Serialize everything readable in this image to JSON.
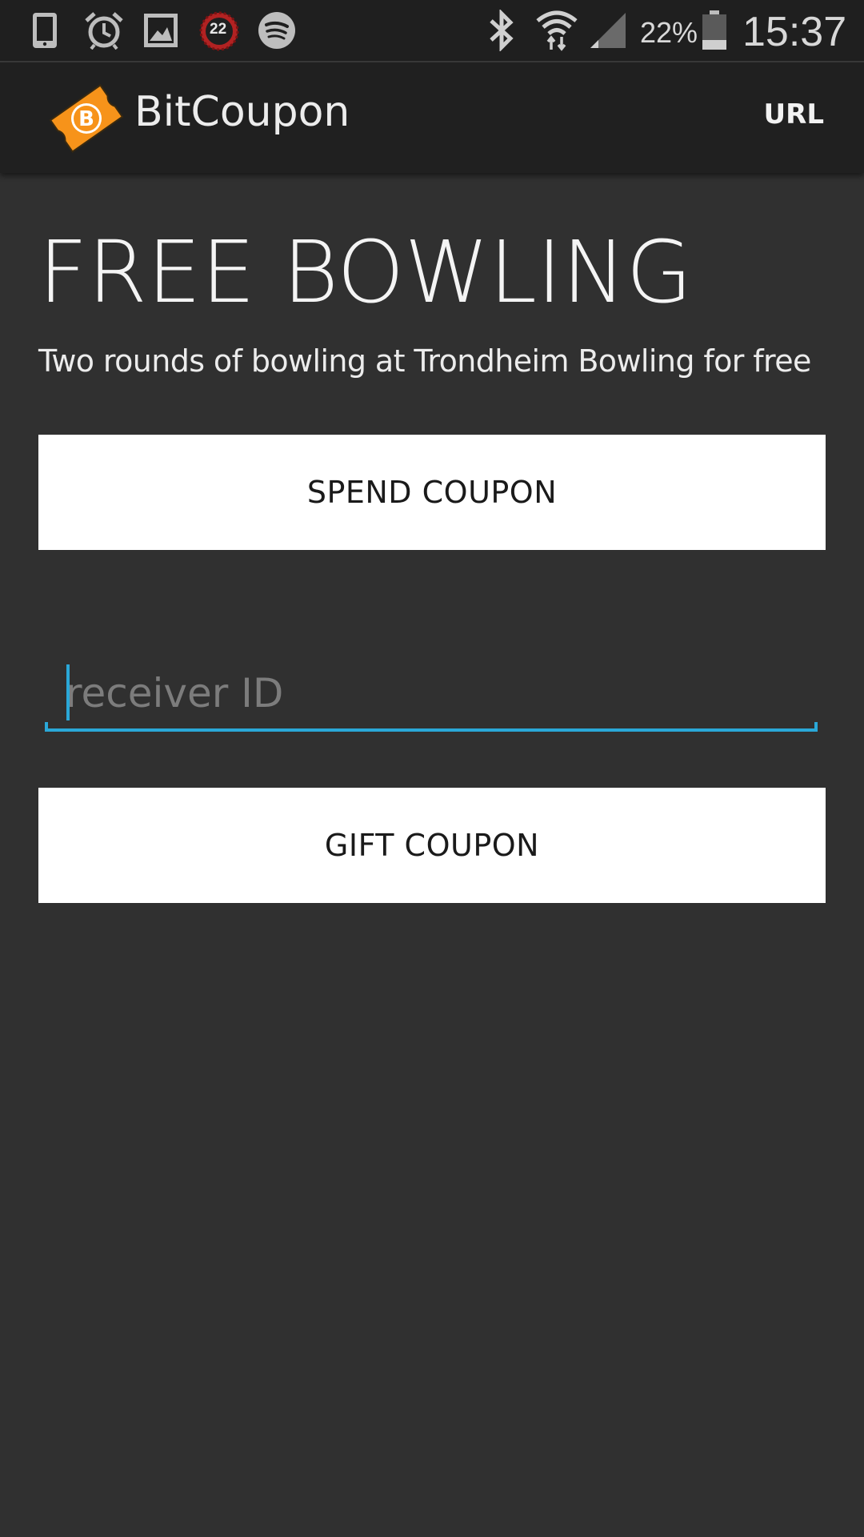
{
  "status_bar": {
    "battery_percent": "22%",
    "time": "15:37",
    "notification_badge": "22",
    "icons": [
      "phone-icon",
      "alarm-icon",
      "gallery-icon",
      "counter-badge-icon",
      "spotify-icon",
      "bluetooth-icon",
      "wifi-icon",
      "signal-icon",
      "battery-icon"
    ]
  },
  "action_bar": {
    "app_title": "BitCoupon",
    "logo_icon": "bitcoin-coupon-logo-icon",
    "url_label": "URL"
  },
  "coupon": {
    "title": "FREE BOWLING",
    "description": "Two rounds of bowling at Trondheim Bowling for free"
  },
  "actions": {
    "spend_label": "SPEND COUPON",
    "gift_label": "GIFT COUPON"
  },
  "receiver": {
    "placeholder": "receiver ID",
    "value": ""
  },
  "colors": {
    "background": "#303030",
    "action_bar": "#202020",
    "accent": "#2aa8d8",
    "logo_orange": "#f7931a"
  }
}
